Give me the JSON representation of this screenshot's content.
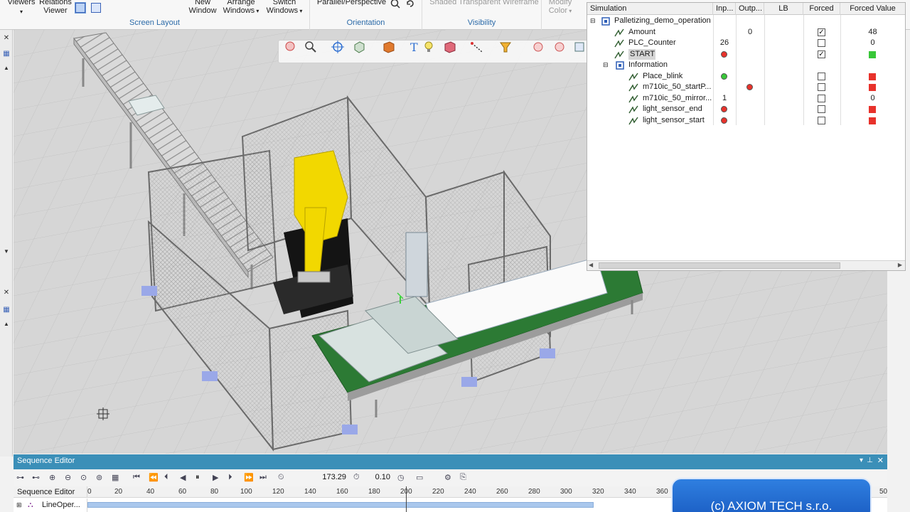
{
  "ribbon": {
    "viewers": "Viewers",
    "relations_viewer": "Relations Viewer",
    "new_window": "New Window",
    "arrange_windows": "Arrange Windows",
    "switch_windows": "Switch Windows",
    "screen_layout": "Screen Layout",
    "parallel_perspective": "Parallel/Perspective",
    "orientation": "Orientation",
    "shaded_transparent_wireframe": "Shaded Transparent Wireframe",
    "visibility": "Visibility",
    "modify_color": "Modify Color"
  },
  "simulation": {
    "columns": [
      "Simulation",
      "Inp...",
      "Outp...",
      "LB",
      "Forced",
      "Forced Value"
    ],
    "rows": [
      {
        "name": "Palletizing_demo_operation",
        "level": 0,
        "inp": "",
        "outp": "",
        "forced": null,
        "fvalue": ""
      },
      {
        "name": "Amount",
        "level": 1,
        "inp": "",
        "outp": "0",
        "forced": true,
        "fvalue": "48"
      },
      {
        "name": "PLC_Counter",
        "level": 1,
        "inp": "26",
        "outp": "",
        "forced": false,
        "fvalue": "0"
      },
      {
        "name": "START",
        "level": 1,
        "inp": "red",
        "outp": "",
        "forced": true,
        "fvalue": "green"
      },
      {
        "name": "Information",
        "level": 1,
        "inp": "",
        "outp": "",
        "forced": null,
        "fvalue": ""
      },
      {
        "name": "Place_blink",
        "level": 2,
        "inp": "green",
        "outp": "",
        "forced": false,
        "fvalue": "red"
      },
      {
        "name": "m710ic_50_startP...",
        "level": 2,
        "inp": "",
        "outp": "red",
        "forced": false,
        "fvalue": "red"
      },
      {
        "name": "m710ic_50_mirror...",
        "level": 2,
        "inp": "1",
        "outp": "",
        "forced": false,
        "fvalue": "0"
      },
      {
        "name": "light_sensor_end",
        "level": 2,
        "inp": "red",
        "outp": "",
        "forced": false,
        "fvalue": "red"
      },
      {
        "name": "light_sensor_start",
        "level": 2,
        "inp": "red",
        "outp": "",
        "forced": false,
        "fvalue": "red"
      }
    ]
  },
  "sequence_editor": {
    "title": "Sequence Editor",
    "current_time": "173.29",
    "time_step": "0.10",
    "column_label": "Sequence Editor",
    "row_label": "LineOper...",
    "ticks": [
      "0",
      "20",
      "40",
      "60",
      "80",
      "100",
      "120",
      "140",
      "160",
      "180",
      "200",
      "220",
      "240",
      "260",
      "280",
      "300",
      "320",
      "340",
      "360"
    ],
    "tick_right": "50"
  },
  "watermark": "(c) AXIOM TECH s.r.o.",
  "colors": {
    "accent": "#3b8fb8",
    "signal_red": "#e8322b",
    "signal_green": "#38c738",
    "robot_yellow": "#f2d800",
    "floor": "#d8d8d8",
    "watermark_blue": "#2a73d8"
  }
}
